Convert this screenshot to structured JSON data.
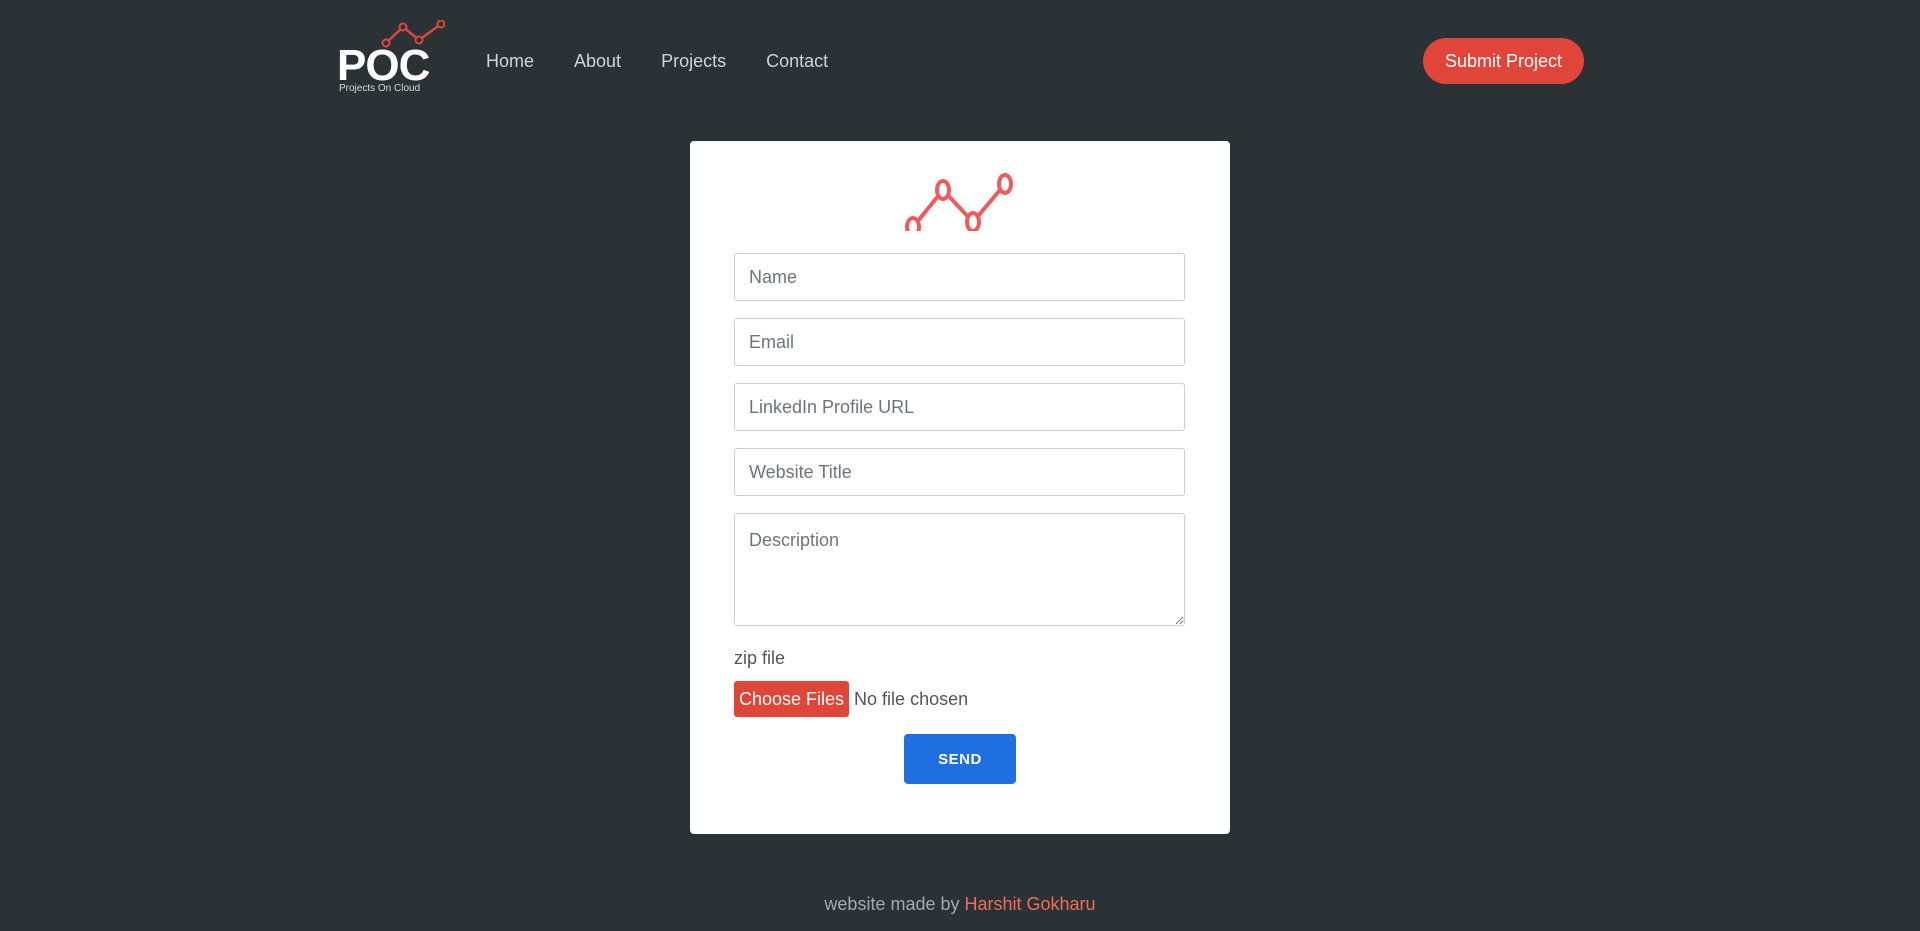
{
  "brand": {
    "logo_text": "POC",
    "logo_sub": "Projects On Cloud",
    "accent_color": "#e0453a"
  },
  "nav": {
    "items": [
      {
        "label": "Home"
      },
      {
        "label": "About"
      },
      {
        "label": "Projects"
      },
      {
        "label": "Contact"
      }
    ],
    "cta_label": "Submit Project"
  },
  "form": {
    "icon": "line-chart-icon",
    "name_placeholder": "Name",
    "email_placeholder": "Email",
    "linkedin_placeholder": "LinkedIn Profile URL",
    "title_placeholder": "Website Title",
    "description_placeholder": "Description",
    "zip_label": "zip file",
    "choose_files_label": "Choose Files",
    "no_file_text": "No file chosen",
    "send_label": "SEND",
    "send_color": "#1e6fe0"
  },
  "footer": {
    "prefix": "website made by",
    "author": "Harshit Gokharu",
    "author_color": "#f26b5b"
  }
}
